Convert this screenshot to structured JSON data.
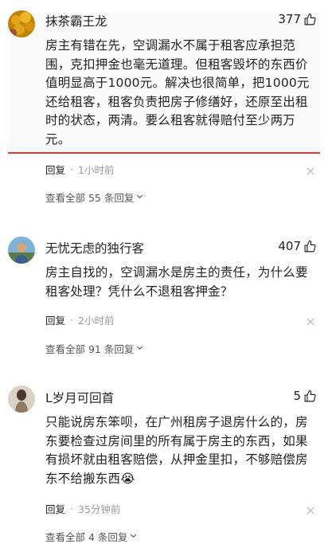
{
  "comments": [
    {
      "name": "抹茶霸王龙",
      "likes": "377",
      "text": "房主有错在先，空调漏水不属于租客应承担范围，克扣押金也毫无道理。但租客毁坏的东西价值明显高于1000元。解决也很简单，把1000元还给租客，租客负责把房子修缮好，还原至出租时的状态，两清。要么租客就得赔付至少两万元。",
      "reply_label": "回复",
      "separator": "·",
      "time": "1小时前",
      "view_all": "查看全部 55 条回复"
    },
    {
      "name": "无忧无虑的独行客",
      "likes": "407",
      "text": "房主自找的，空调漏水是房主的责任，为什么要租客处理？凭什么不退租客押金？",
      "reply_label": "回复",
      "separator": "·",
      "time": "2小时前",
      "view_all": "查看全部 91 条回复"
    },
    {
      "name": "L岁月可回首",
      "likes": "5",
      "text": "只能说房东笨呗，在广州租房子退房什么的，房东要检查过房间里的所有属于房主的东西，如果有损坏就由租客赔偿，从押金里扣，不够赔偿房东不给搬东西😭",
      "reply_label": "回复",
      "separator": "·",
      "time": "35分钟前",
      "view_all": "查看全部 4 条回复"
    }
  ],
  "colors": {
    "highlight_line": "#e8362b",
    "meta_gray": "#999999"
  },
  "icons": {
    "like": "thumbs-up-icon",
    "dismiss": "close-icon",
    "expand": "chevron-down-icon"
  }
}
